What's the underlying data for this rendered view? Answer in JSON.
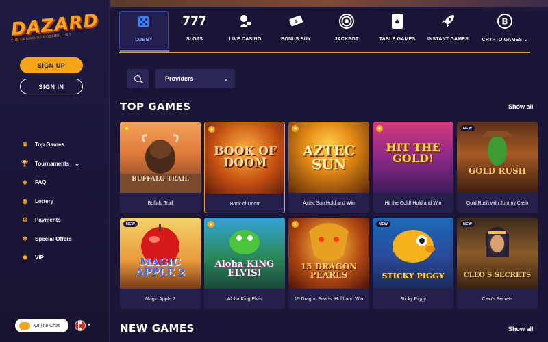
{
  "brand": {
    "name": "DAZARD",
    "tagline": "THE CASINO OF POSSIBILITIES"
  },
  "auth": {
    "signup_label": "SIGN UP",
    "signin_label": "SIGN IN"
  },
  "sidebar": {
    "items": [
      {
        "label": "Top Games",
        "icon": "crown-icon"
      },
      {
        "label": "Tournaments",
        "icon": "trophy-icon"
      },
      {
        "label": "FAQ",
        "icon": "tag-icon"
      },
      {
        "label": "Lottery",
        "icon": "coin-icon"
      },
      {
        "label": "Payments",
        "icon": "gear-icon"
      },
      {
        "label": "Special Offers",
        "icon": "gift-icon"
      },
      {
        "label": "VIP",
        "icon": "vip-crown-icon"
      }
    ],
    "chat_label": "Online Chat"
  },
  "categories": [
    {
      "label": "LOBBY",
      "icon": "dice-icon",
      "active": true
    },
    {
      "label": "SLOTS",
      "icon": "777-icon",
      "glyph": "777"
    },
    {
      "label": "LIVE CASINO",
      "icon": "dealer-icon"
    },
    {
      "label": "BONUS BUY",
      "icon": "bonus-ticket-icon"
    },
    {
      "label": "JACKPOT",
      "icon": "target-icon"
    },
    {
      "label": "TABLE GAMES",
      "icon": "cards-icon"
    },
    {
      "label": "INSTANT GAMES",
      "icon": "rocket-icon"
    },
    {
      "label": "CRYPTO GAMES",
      "icon": "bitcoin-icon"
    }
  ],
  "filters": {
    "providers_label": "Providers"
  },
  "sections": {
    "top_games": {
      "title": "TOP GAMES",
      "show_all": "Show all"
    },
    "new_games": {
      "title": "NEW GAMES",
      "show_all": "Show all"
    }
  },
  "games": [
    {
      "name": "Buffalo Trail",
      "art": "BUFFALO TRAIL",
      "badge": "star"
    },
    {
      "name": "Book of Doom",
      "art": "BOOK OF DOOM",
      "badge": "star"
    },
    {
      "name": "Aztec Sun Hold and Win",
      "art": "AZTEC SUN",
      "badge": "star"
    },
    {
      "name": "Hit the Gold! Hold and Win",
      "art": "HIT THE GOLD!",
      "badge": "star"
    },
    {
      "name": "Gold Rush with Johnny Cash",
      "art": "GOLD RUSH",
      "badge": "NEW"
    },
    {
      "name": "Magic Apple 2",
      "art": "MAGIC APPLE 2",
      "badge": "NEW"
    },
    {
      "name": "Aloha King Elvis",
      "art": "Aloha KING ELVIS!",
      "badge": "star"
    },
    {
      "name": "15 Dragon Pearls: Hold and Win",
      "art": "15 DRAGON PEARLS",
      "badge": "star"
    },
    {
      "name": "Sticky Piggy",
      "art": "STICKY PIGGY",
      "badge": "NEW"
    },
    {
      "name": "Cleo's Secrets",
      "art": "CLEO'S SECRETS",
      "badge": "NEW"
    }
  ]
}
